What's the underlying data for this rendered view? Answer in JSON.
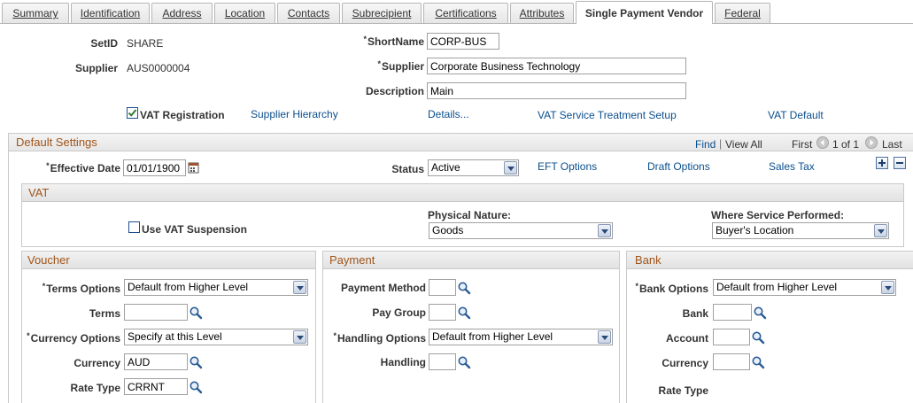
{
  "tabs": [
    {
      "label": "Summary"
    },
    {
      "label": "Identification"
    },
    {
      "label": "Address"
    },
    {
      "label": "Location"
    },
    {
      "label": "Contacts"
    },
    {
      "label": "Subrecipient"
    },
    {
      "label": "Certifications"
    },
    {
      "label": "Attributes"
    },
    {
      "label": "Single Payment Vendor",
      "active": true
    },
    {
      "label": "Federal"
    }
  ],
  "header": {
    "setid_label": "SetID",
    "setid_value": "SHARE",
    "supplier_label": "Supplier",
    "supplier_value": "AUS0000004",
    "shortname_label": "ShortName",
    "shortname_value": "CORP-BUS",
    "supplier_name_label": "Supplier",
    "supplier_name_value": "Corporate Business Technology",
    "description_label": "Description",
    "description_value": "Main",
    "vat_registration_label": "VAT Registration",
    "supplier_hierarchy_link": "Supplier Hierarchy",
    "details_link": "Details...",
    "vat_service_link": "VAT Service Treatment Setup",
    "vat_default_link": "VAT Default"
  },
  "default_settings": {
    "title": "Default Settings",
    "find": "Find",
    "separator": "|",
    "view_all": "View All",
    "first": "First",
    "count": "1 of 1",
    "last": "Last",
    "effective_date_label": "Effective Date",
    "effective_date_value": "01/01/1900",
    "status_label": "Status",
    "status_value": "Active",
    "eft_options_link": "EFT Options",
    "draft_options_link": "Draft Options",
    "sales_tax_link": "Sales Tax"
  },
  "vat": {
    "title": "VAT",
    "use_vat_suspension_label": "Use VAT Suspension",
    "physical_nature_label": "Physical Nature:",
    "physical_nature_value": "Goods",
    "where_service_label": "Where Service Performed:",
    "where_service_value": "Buyer's Location"
  },
  "voucher": {
    "title": "Voucher",
    "terms_options_label": "Terms Options",
    "terms_options_value": "Default from Higher Level",
    "terms_label": "Terms",
    "terms_value": "",
    "currency_options_label": "Currency Options",
    "currency_options_value": "Specify at this Level",
    "currency_label": "Currency",
    "currency_value": "AUD",
    "rate_type_label": "Rate Type",
    "rate_type_value": "CRRNT"
  },
  "payment": {
    "title": "Payment",
    "payment_method_label": "Payment Method",
    "payment_method_value": "",
    "pay_group_label": "Pay Group",
    "pay_group_value": "",
    "handling_options_label": "Handling Options",
    "handling_options_value": "Default from Higher Level",
    "handling_label": "Handling",
    "handling_value": ""
  },
  "bank": {
    "title": "Bank",
    "bank_options_label": "Bank Options",
    "bank_options_value": "Default from Higher Level",
    "bank_label": "Bank",
    "bank_value": "",
    "account_label": "Account",
    "account_value": "",
    "currency_label": "Currency",
    "currency_value": "",
    "rate_type_label": "Rate Type"
  },
  "colors": {
    "link": "#0b4f8e",
    "group_title": "#a05418",
    "checkbox_check": "#2e7d32"
  }
}
